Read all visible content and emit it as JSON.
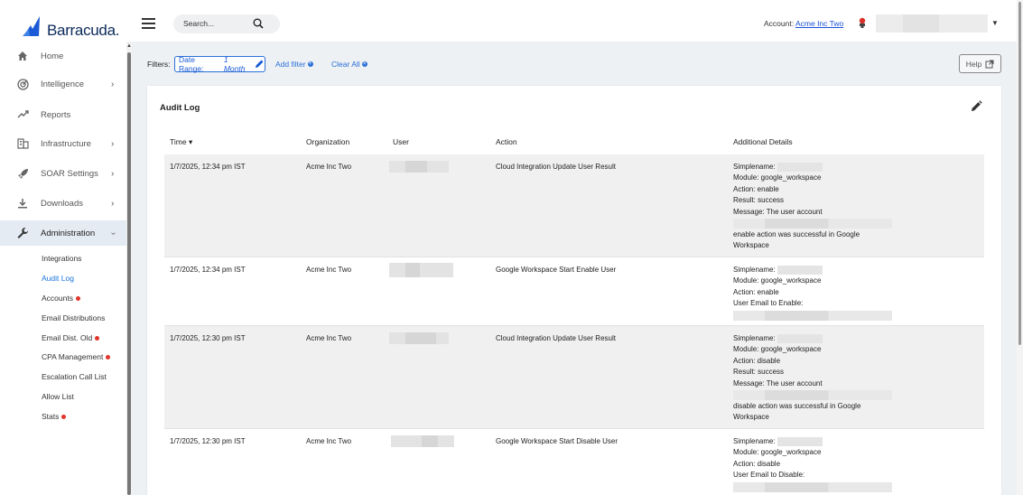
{
  "brand": {
    "name": "Barracuda."
  },
  "sidebar": {
    "items": [
      {
        "label": "Home",
        "icon": "home-icon",
        "has_chevron": false
      },
      {
        "label": "Intelligence",
        "icon": "radar-icon",
        "has_chevron": true
      },
      {
        "label": "Reports",
        "icon": "trend-icon",
        "has_chevron": false
      },
      {
        "label": "Infrastructure",
        "icon": "building-icon",
        "has_chevron": true
      },
      {
        "label": "SOAR Settings",
        "icon": "rocket-icon",
        "has_chevron": true
      },
      {
        "label": "Downloads",
        "icon": "download-icon",
        "has_chevron": true
      },
      {
        "label": "Administration",
        "icon": "wrench-icon",
        "has_chevron": true,
        "expanded": true
      }
    ],
    "sub_items": [
      {
        "label": "Integrations",
        "alert": false
      },
      {
        "label": "Audit Log",
        "alert": false,
        "selected": true
      },
      {
        "label": "Accounts",
        "alert": true
      },
      {
        "label": "Email Distributions",
        "alert": false
      },
      {
        "label": "Email Dist. Old",
        "alert": true
      },
      {
        "label": "CPA Management",
        "alert": true
      },
      {
        "label": "Escalation Call List",
        "alert": false
      },
      {
        "label": "Allow List",
        "alert": false
      },
      {
        "label": "Stats",
        "alert": true
      }
    ]
  },
  "header": {
    "search_placeholder": "Search...",
    "account_label": "Account:",
    "account_name": "Acme Inc Two"
  },
  "filters": {
    "label": "Filters:",
    "date_range_label": "Date Range:",
    "date_range_value": "1 Month",
    "add_filter": "Add filter",
    "clear_all": "Clear All",
    "help": "Help"
  },
  "audit_log": {
    "title": "Audit Log",
    "columns": [
      "Time",
      "Organization",
      "User",
      "Action",
      "Additional Details"
    ],
    "rows": [
      {
        "time": "1/7/2025, 12:34 pm IST",
        "organization": "Acme Inc Two",
        "action": "Cloud Integration Update User Result",
        "details": [
          "Simplename:",
          "Module: google_workspace",
          "Action: enable",
          "Result: success",
          "Message: The user account",
          "",
          "enable action was successful in Google",
          "Workspace"
        ]
      },
      {
        "time": "1/7/2025, 12:34 pm IST",
        "organization": "Acme Inc Two",
        "action": "Google Workspace Start Enable User",
        "details": [
          "Simplename:",
          "Module: google_workspace",
          "Action: enable",
          "User Email to Enable:",
          ""
        ]
      },
      {
        "time": "1/7/2025, 12:30 pm IST",
        "organization": "Acme Inc Two",
        "action": "Cloud Integration Update User Result",
        "details": [
          "Simplename:",
          "Module: google_workspace",
          "Action: disable",
          "Result: success",
          "Message: The user account",
          "",
          "disable action was successful in Google",
          "Workspace"
        ]
      },
      {
        "time": "1/7/2025, 12:30 pm IST",
        "organization": "Acme Inc Two",
        "action": "Google Workspace Start Disable User",
        "details": [
          "Simplename:",
          "Module: google_workspace",
          "Action: disable",
          "User Email to Disable:",
          ""
        ]
      }
    ]
  },
  "colors": {
    "accent": "#1a73d9",
    "alert": "#e2342a",
    "brand": "#0b2a5a"
  }
}
